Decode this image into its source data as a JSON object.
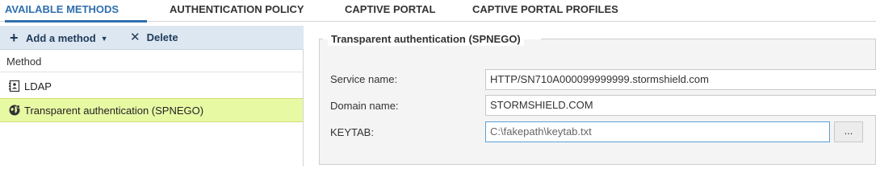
{
  "tabs": [
    {
      "label": "AVAILABLE METHODS",
      "active": true
    },
    {
      "label": "AUTHENTICATION POLICY",
      "active": false
    },
    {
      "label": "CAPTIVE PORTAL",
      "active": false
    },
    {
      "label": "CAPTIVE PORTAL PROFILES",
      "active": false
    }
  ],
  "toolbar": {
    "add_label": "Add a method",
    "delete_label": "Delete"
  },
  "methods": {
    "column_header": "Method",
    "items": [
      {
        "label": "LDAP",
        "icon": "ldap-directory-icon",
        "selected": false
      },
      {
        "label": "Transparent authentication (SPNEGO)",
        "icon": "spnego-globe-icon",
        "selected": true
      }
    ]
  },
  "details": {
    "legend": "Transparent authentication (SPNEGO)",
    "fields": [
      {
        "label": "Service name:",
        "value": "HTTP/SN710A000099999999.stormshield.com"
      },
      {
        "label": "Domain name:",
        "value": "STORMSHIELD.COM"
      },
      {
        "label": "KEYTAB:",
        "value": "C:\\fakepath\\keytab.txt"
      }
    ],
    "browse_label": "..."
  },
  "colors": {
    "accent": "#2f6fae",
    "toolbar_bg": "#dde7f1",
    "selected_row": "#e8f9a4"
  }
}
